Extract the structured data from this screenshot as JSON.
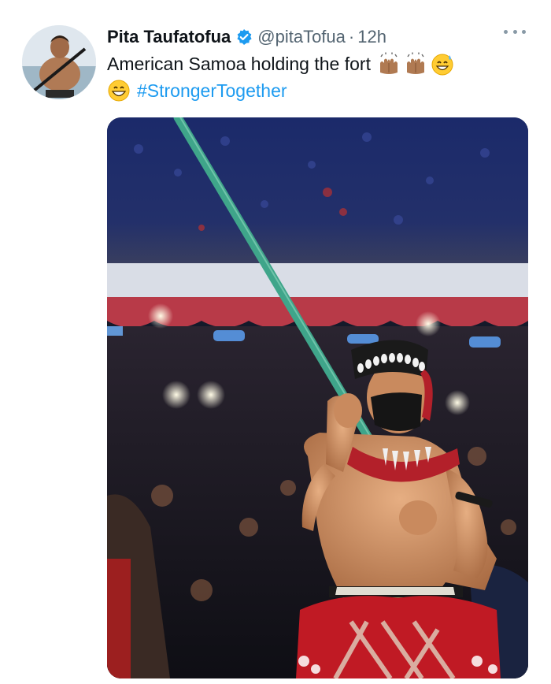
{
  "tweet": {
    "author_name": "Pita Taufatofua",
    "handle": "@pitaTofua",
    "separator": "·",
    "time": "12h",
    "text_line1": "American Samoa holding the fort",
    "hashtag": "#StrongerTogether",
    "emojis": [
      "raising-hands-medium-skin",
      "raising-hands-medium-skin",
      "grinning-sweat-face",
      "grinning-face"
    ]
  },
  "colors": {
    "verified": "#1d9bf0",
    "hashtag": "#1d9bf0",
    "secondary_text": "#536471",
    "primary_text": "#0f1419"
  },
  "icons": {
    "verified": "verified-badge-icon",
    "more": "more-options-icon"
  }
}
